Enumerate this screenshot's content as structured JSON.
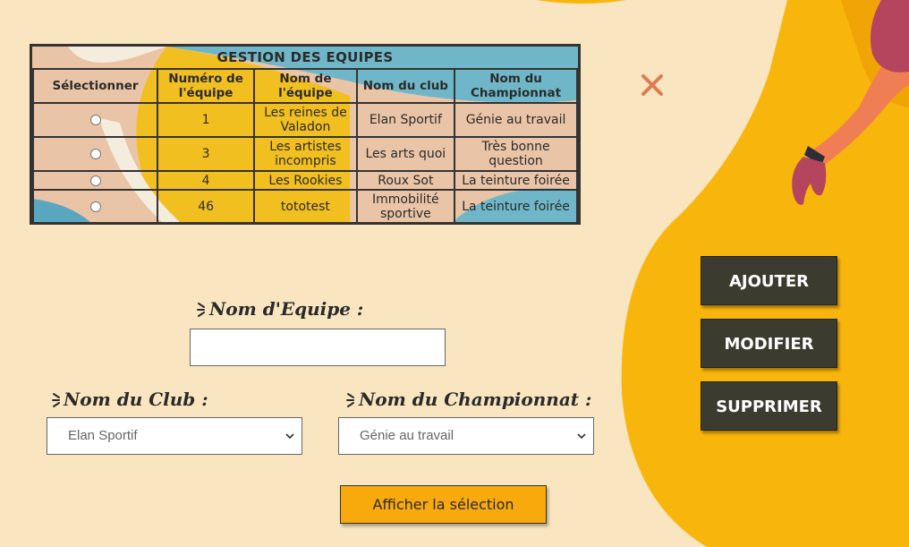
{
  "table": {
    "caption": "GESTION DES EQUIPES",
    "headers": [
      "Sélectionner",
      "Numéro de l'équipe",
      "Nom de l'équipe",
      "Nom du club",
      "Nom du Championnat"
    ],
    "rows": [
      {
        "numero": "1",
        "nom": "Les reines de Valadon",
        "club": "Elan Sportif",
        "championnat": "Génie au travail"
      },
      {
        "numero": "3",
        "nom": "Les artistes incompris",
        "club": "Les arts quoi",
        "championnat": "Très bonne question"
      },
      {
        "numero": "4",
        "nom": "Les Rookies",
        "club": "Roux Sot",
        "championnat": "La teinture foirée"
      },
      {
        "numero": "46",
        "nom": "tototest",
        "club": "Immobilité sportive",
        "championnat": "La teinture foirée"
      }
    ]
  },
  "form": {
    "team_name_label": "Nom d'Equipe :",
    "team_name_value": "",
    "club_label": "Nom du Club :",
    "club_selected": "Elan Sportif",
    "championship_label": "Nom du Championnat :",
    "championship_selected": "Génie au travail",
    "show_button": "Afficher la sélection"
  },
  "actions": {
    "add": "AJOUTER",
    "modify": "MODIFIER",
    "delete": "SUPPRIMER"
  },
  "icons": {
    "close": "close-icon",
    "select_chevron": "chevron-down-icon"
  },
  "colors": {
    "background": "#f9e6c1",
    "accent_yellow": "#f8b50c",
    "button_dark": "#3b3b30",
    "close_icon": "#e07a52"
  }
}
